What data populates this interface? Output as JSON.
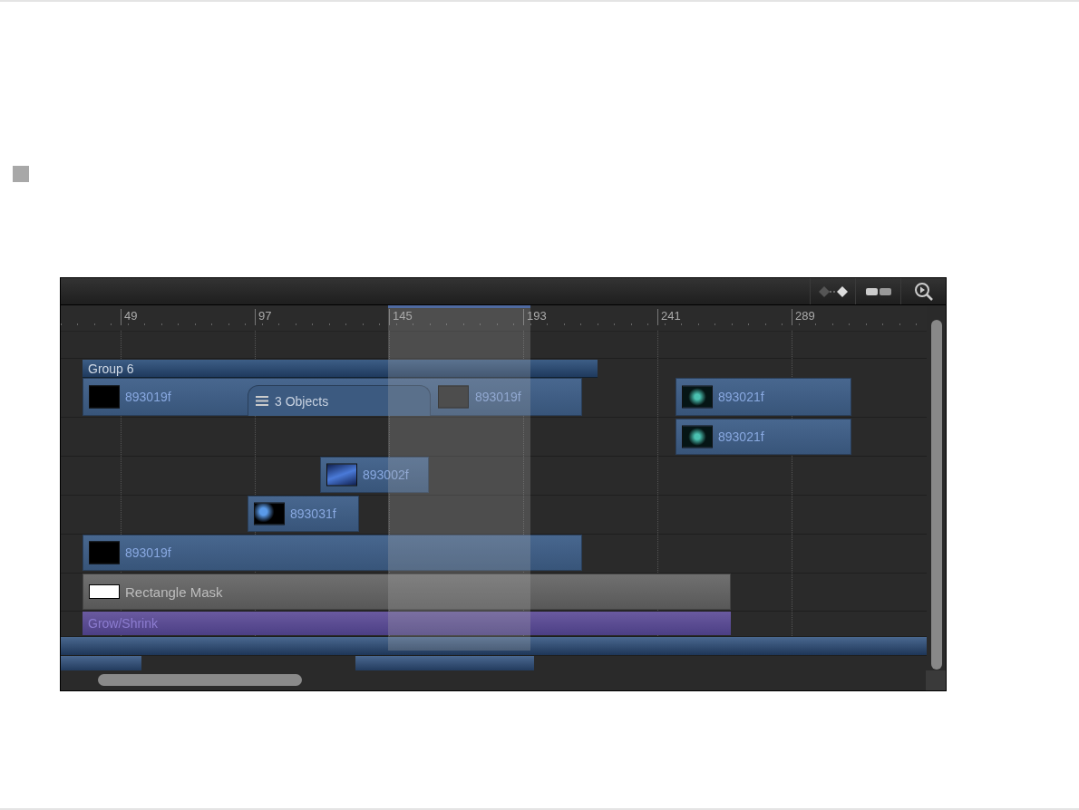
{
  "ruler": {
    "labels": [
      "49",
      "97",
      "145",
      "193",
      "241",
      "289"
    ]
  },
  "clips": [
    {
      "kind": "group",
      "label": "Group 6"
    },
    {
      "kind": "stack",
      "label": "3 Objects",
      "clips": [
        "893019f",
        "893019f"
      ]
    },
    {
      "kind": "media",
      "label": "893021f"
    },
    {
      "kind": "media",
      "label": "893021f"
    },
    {
      "kind": "media",
      "label": "893002f"
    },
    {
      "kind": "media",
      "label": "893031f"
    },
    {
      "kind": "media",
      "label": "893019f"
    },
    {
      "kind": "mask",
      "label": "Rectangle Mask"
    },
    {
      "kind": "behavior",
      "label": "Grow/Shrink"
    },
    {
      "kind": "track"
    },
    {
      "kind": "track"
    },
    {
      "kind": "track"
    }
  ]
}
